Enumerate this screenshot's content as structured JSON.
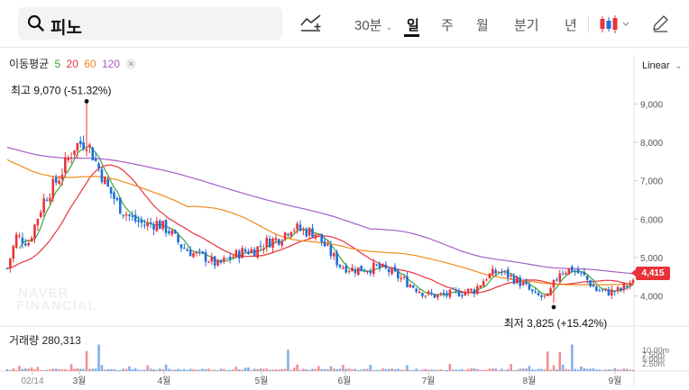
{
  "search": {
    "query": "피노"
  },
  "timeframes": [
    "30분",
    "일",
    "주",
    "월",
    "분기",
    "년"
  ],
  "active_timeframe": "일",
  "ma_legend": {
    "label": "이동평균",
    "periods": [
      {
        "value": "5",
        "color": "#3aa63a"
      },
      {
        "value": "20",
        "color": "#e8333a"
      },
      {
        "value": "60",
        "color": "#f08a1c"
      },
      {
        "value": "120",
        "color": "#a35fc9"
      }
    ]
  },
  "scale_mode": "Linear",
  "current_price_label": "4,415",
  "high_annotation": "최고 9,070 (-51.32%)",
  "low_annotation": "최저 3,825 (+15.42%)",
  "volume_label": "거래량 280,313",
  "watermark": [
    "NAVER",
    "FINANCIAL"
  ],
  "colors": {
    "up": "#e8333a",
    "down": "#1d6fd8"
  },
  "chart_data": {
    "type": "candlestick",
    "x_ticks": [
      "02/14",
      "3월",
      "4월",
      "5월",
      "6월",
      "7월",
      "8월",
      "9월"
    ],
    "y_ticks": [
      "9,000",
      "8,000",
      "7,000",
      "6,000",
      "5,000",
      "4,000"
    ],
    "ylim": [
      3450,
      9550
    ],
    "volume_ticks": [
      "10.00m",
      "7.50m",
      "5.00m",
      "2.50m"
    ],
    "high": 9070,
    "low": 3825,
    "last": 4415,
    "price_path": [
      [
        0,
        4720
      ],
      [
        3,
        5550
      ],
      [
        7,
        5400
      ],
      [
        12,
        6500
      ],
      [
        17,
        7100
      ],
      [
        22,
        7900
      ],
      [
        26,
        8050
      ],
      [
        29,
        7500
      ],
      [
        33,
        6800
      ],
      [
        37,
        6300
      ],
      [
        41,
        6000
      ],
      [
        45,
        5850
      ],
      [
        49,
        5900
      ],
      [
        53,
        5700
      ],
      [
        57,
        5300
      ],
      [
        61,
        5100
      ],
      [
        65,
        5000
      ],
      [
        69,
        4800
      ],
      [
        73,
        5000
      ],
      [
        77,
        5150
      ],
      [
        81,
        5200
      ],
      [
        85,
        5400
      ],
      [
        89,
        5500
      ],
      [
        93,
        5800
      ],
      [
        97,
        5700
      ],
      [
        101,
        5650
      ],
      [
        105,
        5200
      ],
      [
        109,
        4800
      ],
      [
        113,
        4700
      ],
      [
        117,
        4700
      ],
      [
        121,
        4750
      ],
      [
        125,
        4650
      ],
      [
        129,
        4450
      ],
      [
        133,
        4250
      ],
      [
        137,
        4050
      ],
      [
        141,
        4000
      ],
      [
        145,
        4050
      ],
      [
        149,
        4100
      ],
      [
        153,
        4150
      ],
      [
        157,
        4500
      ],
      [
        161,
        4650
      ],
      [
        165,
        4500
      ],
      [
        169,
        4300
      ],
      [
        173,
        4000
      ],
      [
        177,
        3950
      ],
      [
        179,
        4300
      ],
      [
        181,
        4650
      ],
      [
        185,
        4700
      ],
      [
        189,
        4500
      ],
      [
        193,
        4150
      ],
      [
        197,
        4100
      ],
      [
        201,
        4150
      ],
      [
        205,
        4415
      ]
    ],
    "trading_days": 206
  }
}
